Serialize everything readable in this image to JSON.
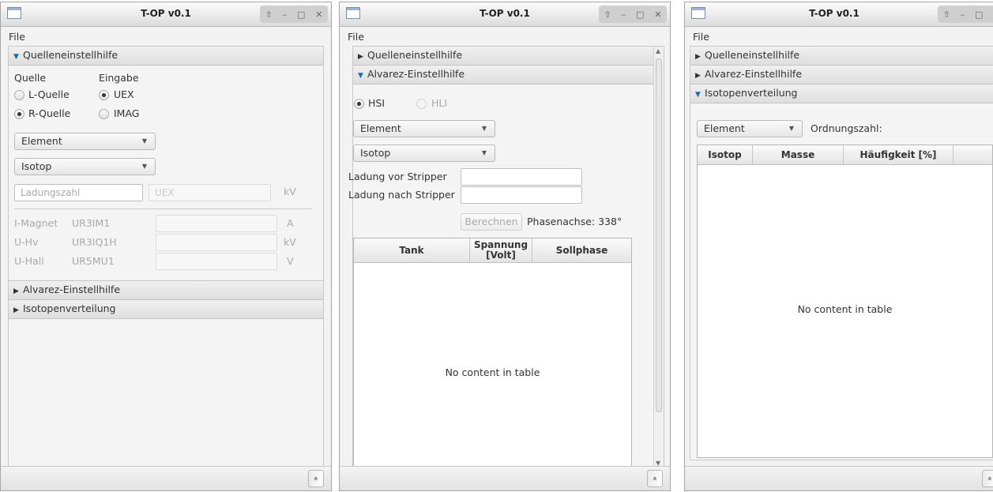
{
  "window": {
    "title": "T-OP v0.1",
    "menu_file": "File",
    "controls": [
      "⇧",
      "–",
      "□",
      "✕"
    ]
  },
  "panels": {
    "quellen": "Quelleneinstellhilfe",
    "alvarez": "Alvarez-Einstellhilfe",
    "isotopen": "Isotopenverteilung"
  },
  "quellen": {
    "quelle_label": "Quelle",
    "eingabe_label": "Eingabe",
    "l_quelle": "L-Quelle",
    "r_quelle": "R-Quelle",
    "uex": "UEX",
    "imag": "IMAG",
    "selected_quelle": "R-Quelle",
    "selected_eingabe": "UEX",
    "element_combo": "Element",
    "isotop_combo": "Isotop",
    "ladungszahl_placeholder": "Ladungszahl",
    "uex_placeholder": "UEX",
    "kv_unit": "kV",
    "rows": [
      {
        "name": "I-Magnet",
        "device": "UR3IM1",
        "unit": "A"
      },
      {
        "name": "U-Hv",
        "device": "UR3IQ1H",
        "unit": "kV"
      },
      {
        "name": "U-Hall",
        "device": "UR5MU1",
        "unit": "V"
      }
    ]
  },
  "alvarez": {
    "hsi": "HSI",
    "hli": "HLI",
    "element_combo": "Element",
    "isotop_combo": "Isotop",
    "ladung_vor": "Ladung vor Stripper",
    "ladung_nach": "Ladung nach Stripper",
    "berechnen": "Berechnen",
    "phasenachse": "Phasenachse: 338°",
    "columns": [
      "Tank",
      "Spannung [Volt]",
      "Sollphase"
    ],
    "empty_text": "No content in table"
  },
  "isotopen": {
    "element_combo": "Element",
    "ordnungszahl_label": "Ordnungszahl:",
    "columns": [
      "Isotop",
      "Masse",
      "Häufigkeit [%]"
    ],
    "empty_text": "No content in table"
  },
  "statusbar": {
    "collapse_icon": "«"
  },
  "icons": {
    "window_icon": "window-icon",
    "expanded": "triangle-down-icon",
    "collapsed": "triangle-right-icon",
    "accent": "#1c6ea4"
  }
}
